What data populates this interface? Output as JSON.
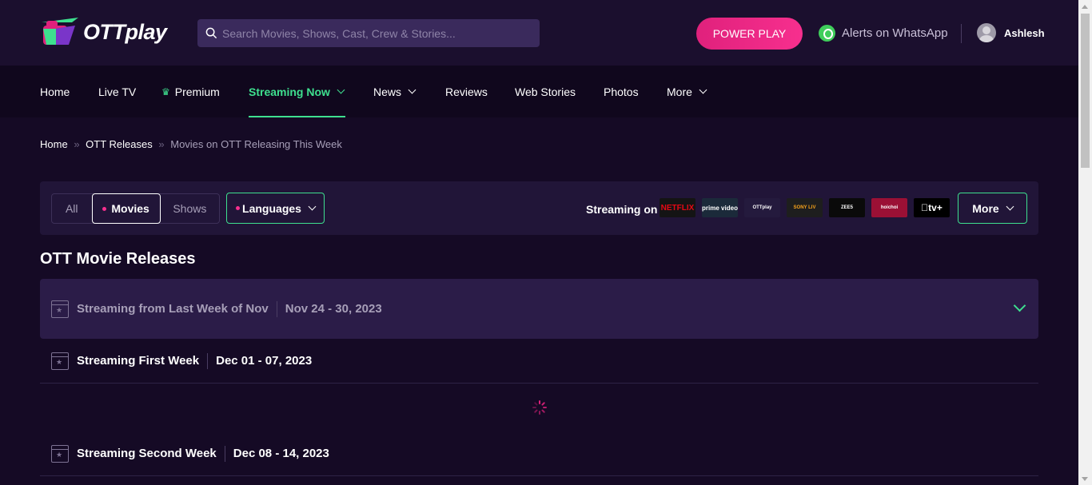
{
  "header": {
    "logo_text": "OTTplay",
    "search_placeholder": "Search Movies, Shows, Cast, Crew & Stories...",
    "power_play_label": "POWER PLAY",
    "whatsapp_label": "Alerts on WhatsApp",
    "user_name": "Ashlesh"
  },
  "nav": {
    "items": [
      {
        "label": "Home"
      },
      {
        "label": "Live TV"
      },
      {
        "label": "Premium"
      },
      {
        "label": "Streaming Now"
      },
      {
        "label": "News"
      },
      {
        "label": "Reviews"
      },
      {
        "label": "Web Stories"
      },
      {
        "label": "Photos"
      },
      {
        "label": "More"
      }
    ]
  },
  "breadcrumb": {
    "home": "Home",
    "sep": "»",
    "releases": "OTT Releases",
    "current": "Movies on OTT Releasing This Week"
  },
  "filters": {
    "all": "All",
    "movies": "Movies",
    "shows": "Shows",
    "languages": "Languages",
    "streaming_on": "Streaming on",
    "more": "More",
    "providers": [
      {
        "label": "NETFLIX",
        "bg": "#141414",
        "color": "#e50914"
      },
      {
        "label": "prime video",
        "bg": "#1b2a3a",
        "color": "#ffffff"
      },
      {
        "label": "OTTplay",
        "bg": "#241a3d",
        "color": "#ffffff"
      },
      {
        "label": "SONY LIV",
        "bg": "#1e1e1e",
        "color": "#f7a21b"
      },
      {
        "label": "ZEE5",
        "bg": "#0a0a0a",
        "color": "#ffffff"
      },
      {
        "label": "hoichoi",
        "bg": "#9b1035",
        "color": "#ffffff"
      },
      {
        "label": "tv+",
        "bg": "#000000",
        "color": "#ffffff"
      }
    ]
  },
  "section_title": "OTT Movie Releases",
  "weeks": [
    {
      "label": "Streaming from Last Week of Nov",
      "dates": "Nov 24 - 30, 2023"
    },
    {
      "label": "Streaming First Week",
      "dates": "Dec 01 - 07, 2023"
    },
    {
      "label": "Streaming Second Week",
      "dates": "Dec 08 - 14, 2023"
    }
  ]
}
